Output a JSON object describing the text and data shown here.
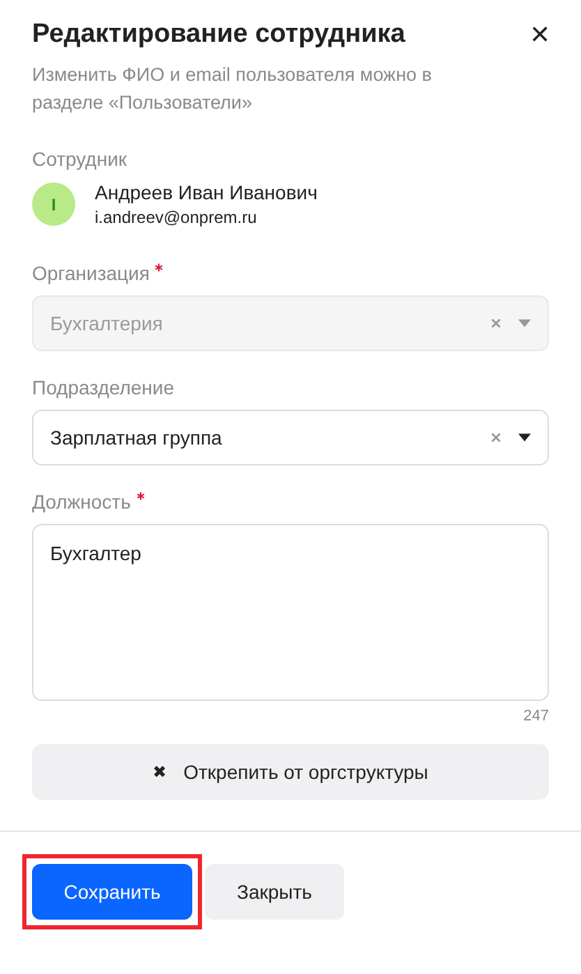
{
  "dialog": {
    "title": "Редактирование сотрудника",
    "close": "✕",
    "hint": "Изменить ФИО и email пользователя можно в разделе «Пользователи»"
  },
  "employee": {
    "label": "Сотрудник",
    "initial": "I",
    "name": "Андреев Иван Иванович",
    "email": "i.andreev@onprem.ru"
  },
  "fields": [
    {
      "kind": "select",
      "label": "Организация",
      "required": true,
      "value": "Бухгалтерия",
      "disabled": true
    },
    {
      "kind": "select",
      "label": "Подразделение",
      "required": false,
      "value": "Зарплатная группа",
      "disabled": false
    },
    {
      "kind": "textarea",
      "label": "Должность",
      "required": true,
      "value": "Бухгалтер",
      "disabled": false,
      "counter": "247"
    }
  ],
  "unpin_button": {
    "icon": "✖",
    "label": "Открепить от оргструктуры"
  },
  "footer_buttons": [
    {
      "label": "Сохранить",
      "primary": true,
      "highlighted": true
    },
    {
      "label": "Закрыть",
      "primary": false,
      "highlighted": false
    }
  ]
}
